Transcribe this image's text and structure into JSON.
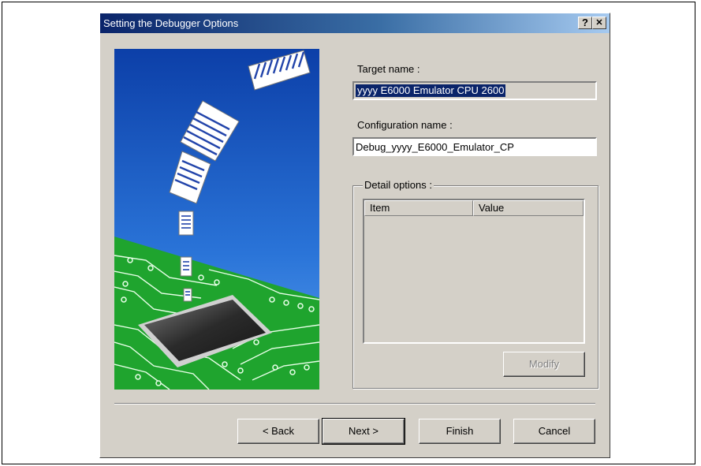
{
  "window": {
    "title": "Setting the Debugger Options",
    "help_button": "?",
    "close_button": "✕"
  },
  "target": {
    "label": "Target name :",
    "value": "yyyy E6000 Emulator CPU 2600"
  },
  "configuration": {
    "label": "Configuration name :",
    "value": "Debug_yyyy_E6000_Emulator_CP"
  },
  "detail_options": {
    "label": "Detail options :",
    "columns": [
      "Item",
      "Value"
    ],
    "modify_button": "Modify"
  },
  "buttons": {
    "back": "< Back",
    "next": "Next >",
    "finish": "Finish",
    "cancel": "Cancel"
  },
  "colors": {
    "title_start": "#0a246a",
    "title_end": "#a6caf0",
    "face": "#d4d0c8",
    "sky": "#1e5cc8",
    "board": "#22a832",
    "chip": "#3a3a3a"
  },
  "illustration": {
    "icon": "chip-with-flying-documents-illustration"
  }
}
